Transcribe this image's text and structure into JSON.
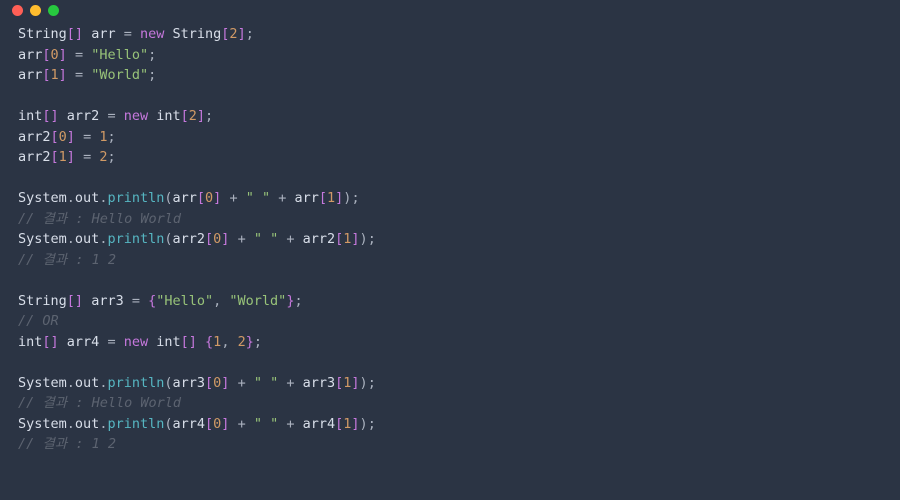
{
  "window": {
    "traffic_lights": [
      "close",
      "minimize",
      "zoom"
    ]
  },
  "code": {
    "lines": [
      [
        [
          "type",
          "String"
        ],
        [
          "bracket",
          "[]"
        ],
        [
          "op",
          " "
        ],
        [
          "ident",
          "arr"
        ],
        [
          "op",
          " = "
        ],
        [
          "keyword",
          "new"
        ],
        [
          "op",
          " "
        ],
        [
          "type",
          "String"
        ],
        [
          "bracket",
          "["
        ],
        [
          "num",
          "2"
        ],
        [
          "bracket",
          "]"
        ],
        [
          "punct",
          ";"
        ]
      ],
      [
        [
          "ident",
          "arr"
        ],
        [
          "bracket",
          "["
        ],
        [
          "num",
          "0"
        ],
        [
          "bracket",
          "]"
        ],
        [
          "op",
          " = "
        ],
        [
          "str",
          "\"Hello\""
        ],
        [
          "punct",
          ";"
        ]
      ],
      [
        [
          "ident",
          "arr"
        ],
        [
          "bracket",
          "["
        ],
        [
          "num",
          "1"
        ],
        [
          "bracket",
          "]"
        ],
        [
          "op",
          " = "
        ],
        [
          "str",
          "\"World\""
        ],
        [
          "punct",
          ";"
        ]
      ],
      [],
      [
        [
          "type",
          "int"
        ],
        [
          "bracket",
          "[]"
        ],
        [
          "op",
          " "
        ],
        [
          "ident",
          "arr2"
        ],
        [
          "op",
          " = "
        ],
        [
          "keyword",
          "new"
        ],
        [
          "op",
          " "
        ],
        [
          "type",
          "int"
        ],
        [
          "bracket",
          "["
        ],
        [
          "num",
          "2"
        ],
        [
          "bracket",
          "]"
        ],
        [
          "punct",
          ";"
        ]
      ],
      [
        [
          "ident",
          "arr2"
        ],
        [
          "bracket",
          "["
        ],
        [
          "num",
          "0"
        ],
        [
          "bracket",
          "]"
        ],
        [
          "op",
          " = "
        ],
        [
          "num",
          "1"
        ],
        [
          "punct",
          ";"
        ]
      ],
      [
        [
          "ident",
          "arr2"
        ],
        [
          "bracket",
          "["
        ],
        [
          "num",
          "1"
        ],
        [
          "bracket",
          "]"
        ],
        [
          "op",
          " = "
        ],
        [
          "num",
          "2"
        ],
        [
          "punct",
          ";"
        ]
      ],
      [],
      [
        [
          "ident",
          "System"
        ],
        [
          "punct",
          "."
        ],
        [
          "ident",
          "out"
        ],
        [
          "punct",
          "."
        ],
        [
          "func",
          "println"
        ],
        [
          "punct",
          "("
        ],
        [
          "ident",
          "arr"
        ],
        [
          "bracket",
          "["
        ],
        [
          "num",
          "0"
        ],
        [
          "bracket",
          "]"
        ],
        [
          "op",
          " + "
        ],
        [
          "str",
          "\" \""
        ],
        [
          "op",
          " + "
        ],
        [
          "ident",
          "arr"
        ],
        [
          "bracket",
          "["
        ],
        [
          "num",
          "1"
        ],
        [
          "bracket",
          "]"
        ],
        [
          "punct",
          ")"
        ],
        [
          "punct",
          ";"
        ]
      ],
      [
        [
          "comment",
          "// 결과 : Hello World"
        ]
      ],
      [
        [
          "ident",
          "System"
        ],
        [
          "punct",
          "."
        ],
        [
          "ident",
          "out"
        ],
        [
          "punct",
          "."
        ],
        [
          "func",
          "println"
        ],
        [
          "punct",
          "("
        ],
        [
          "ident",
          "arr2"
        ],
        [
          "bracket",
          "["
        ],
        [
          "num",
          "0"
        ],
        [
          "bracket",
          "]"
        ],
        [
          "op",
          " + "
        ],
        [
          "str",
          "\" \""
        ],
        [
          "op",
          " + "
        ],
        [
          "ident",
          "arr2"
        ],
        [
          "bracket",
          "["
        ],
        [
          "num",
          "1"
        ],
        [
          "bracket",
          "]"
        ],
        [
          "punct",
          ")"
        ],
        [
          "punct",
          ";"
        ]
      ],
      [
        [
          "comment",
          "// 결과 : 1 2"
        ]
      ],
      [],
      [
        [
          "type",
          "String"
        ],
        [
          "bracket",
          "[]"
        ],
        [
          "op",
          " "
        ],
        [
          "ident",
          "arr3"
        ],
        [
          "op",
          " = "
        ],
        [
          "bracket",
          "{"
        ],
        [
          "str",
          "\"Hello\""
        ],
        [
          "punct",
          ", "
        ],
        [
          "str",
          "\"World\""
        ],
        [
          "bracket",
          "}"
        ],
        [
          "punct",
          ";"
        ]
      ],
      [
        [
          "comment",
          "// OR"
        ]
      ],
      [
        [
          "type",
          "int"
        ],
        [
          "bracket",
          "[]"
        ],
        [
          "op",
          " "
        ],
        [
          "ident",
          "arr4"
        ],
        [
          "op",
          " = "
        ],
        [
          "keyword",
          "new"
        ],
        [
          "op",
          " "
        ],
        [
          "type",
          "int"
        ],
        [
          "bracket",
          "[]"
        ],
        [
          "op",
          " "
        ],
        [
          "bracket",
          "{"
        ],
        [
          "num",
          "1"
        ],
        [
          "punct",
          ", "
        ],
        [
          "num",
          "2"
        ],
        [
          "bracket",
          "}"
        ],
        [
          "punct",
          ";"
        ]
      ],
      [],
      [
        [
          "ident",
          "System"
        ],
        [
          "punct",
          "."
        ],
        [
          "ident",
          "out"
        ],
        [
          "punct",
          "."
        ],
        [
          "func",
          "println"
        ],
        [
          "punct",
          "("
        ],
        [
          "ident",
          "arr3"
        ],
        [
          "bracket",
          "["
        ],
        [
          "num",
          "0"
        ],
        [
          "bracket",
          "]"
        ],
        [
          "op",
          " + "
        ],
        [
          "str",
          "\" \""
        ],
        [
          "op",
          " + "
        ],
        [
          "ident",
          "arr3"
        ],
        [
          "bracket",
          "["
        ],
        [
          "num",
          "1"
        ],
        [
          "bracket",
          "]"
        ],
        [
          "punct",
          ")"
        ],
        [
          "punct",
          ";"
        ]
      ],
      [
        [
          "comment",
          "// 결과 : Hello World"
        ]
      ],
      [
        [
          "ident",
          "System"
        ],
        [
          "punct",
          "."
        ],
        [
          "ident",
          "out"
        ],
        [
          "punct",
          "."
        ],
        [
          "func",
          "println"
        ],
        [
          "punct",
          "("
        ],
        [
          "ident",
          "arr4"
        ],
        [
          "bracket",
          "["
        ],
        [
          "num",
          "0"
        ],
        [
          "bracket",
          "]"
        ],
        [
          "op",
          " + "
        ],
        [
          "str",
          "\" \""
        ],
        [
          "op",
          " + "
        ],
        [
          "ident",
          "arr4"
        ],
        [
          "bracket",
          "["
        ],
        [
          "num",
          "1"
        ],
        [
          "bracket",
          "]"
        ],
        [
          "punct",
          ")"
        ],
        [
          "punct",
          ";"
        ]
      ],
      [
        [
          "comment",
          "// 결과 : 1 2"
        ]
      ]
    ]
  }
}
